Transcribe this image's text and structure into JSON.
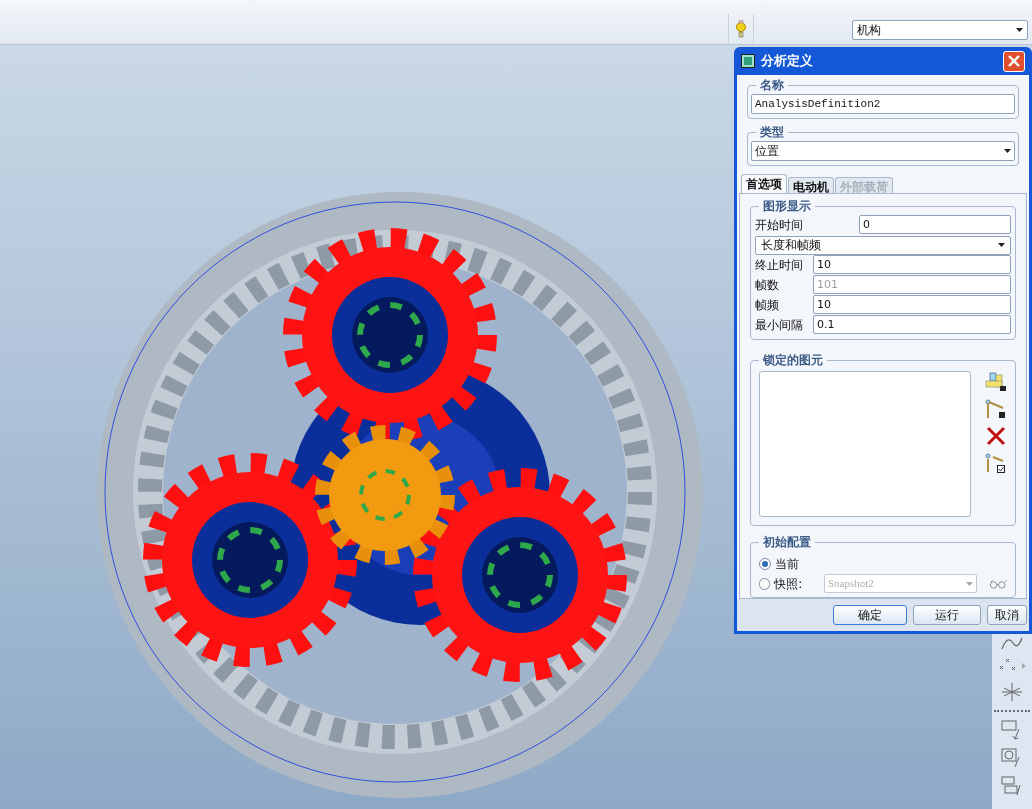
{
  "toolbar": {
    "mode_select": "机构"
  },
  "dialog": {
    "title": "分析定义",
    "name_group": {
      "label": "名称",
      "value": "AnalysisDefinition2"
    },
    "type_group": {
      "label": "类型",
      "value": "位置"
    },
    "tabs": [
      {
        "label": "首选项",
        "selected": true,
        "disabled": false
      },
      {
        "label": "电动机",
        "selected": false,
        "disabled": false
      },
      {
        "label": "外部载荷",
        "selected": false,
        "disabled": true
      }
    ],
    "graphics": {
      "label": "图形显示",
      "start_time": {
        "label": "开始时间",
        "value": "0"
      },
      "mode": "长度和帧频",
      "fields": [
        {
          "label": "终止时间",
          "value": "10",
          "disabled": false
        },
        {
          "label": "帧数",
          "value": "101",
          "disabled": true
        },
        {
          "label": "帧频",
          "value": "10",
          "disabled": false
        },
        {
          "label": "最小间隔",
          "value": "0.1",
          "disabled": false
        }
      ]
    },
    "locked": {
      "label": "锁定的图元"
    },
    "initial": {
      "label": "初始配置",
      "options": [
        {
          "label": "当前",
          "selected": true
        },
        {
          "label": "快照:",
          "selected": false
        }
      ],
      "snapshot": "Snapshot2"
    },
    "buttons": [
      "确定",
      "运行",
      "取消"
    ]
  }
}
